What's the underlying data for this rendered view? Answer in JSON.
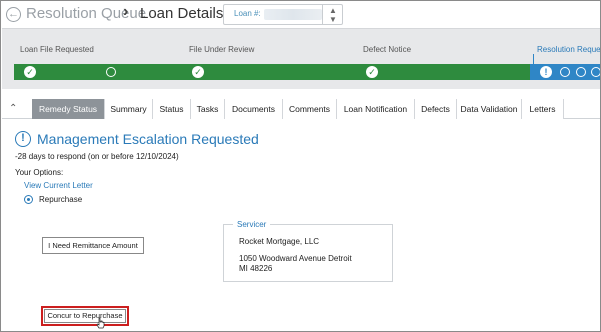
{
  "header": {
    "breadcrumb_queue": "Resolution Queue",
    "breadcrumb_sep": "›",
    "breadcrumb_current": "Loan Details",
    "loan_label": "Loan #:",
    "loan_value": "",
    "back_icon": "back-arrow-icon",
    "stepper_icon": "up-down-stepper-icon"
  },
  "progress": {
    "stages": [
      {
        "label": "Loan File Requested",
        "state": "complete"
      },
      {
        "label": "File Under Review",
        "state": "complete"
      },
      {
        "label": "Defect Notice",
        "state": "complete"
      },
      {
        "label": "Resolution Request",
        "state": "active"
      }
    ],
    "colors": {
      "complete": "#2e8b3e",
      "active": "#2f86c6",
      "band": "#e7e8ea"
    }
  },
  "tabs": {
    "collapse_icon": "chevron-up-icon",
    "items": [
      {
        "label": "Remedy Status",
        "active": true
      },
      {
        "label": "Summary",
        "active": false
      },
      {
        "label": "Status",
        "active": false
      },
      {
        "label": "Tasks",
        "active": false
      },
      {
        "label": "Documents",
        "active": false
      },
      {
        "label": "Comments",
        "active": false
      },
      {
        "label": "Loan Notification",
        "active": false
      },
      {
        "label": "Defects",
        "active": false
      },
      {
        "label": "Data Validation",
        "active": false
      },
      {
        "label": "Letters",
        "active": false
      }
    ]
  },
  "content": {
    "status_icon": "!",
    "title": "Management Escalation Requested",
    "deadline": "-28 days to respond (on or before 12/10/2024)",
    "options_label": "Your Options:",
    "view_letter": "View Current Letter",
    "radio_label": "Repurchase",
    "remittance_button": "I Need Remittance Amount",
    "servicer": {
      "legend": "Servicer",
      "name": "Rocket Mortgage, LLC",
      "address": "1050 Woodward Avenue Detroit MI 48226"
    },
    "concur_button": "Concur to Repurchase",
    "highlight_color": "#cc1f1f"
  }
}
